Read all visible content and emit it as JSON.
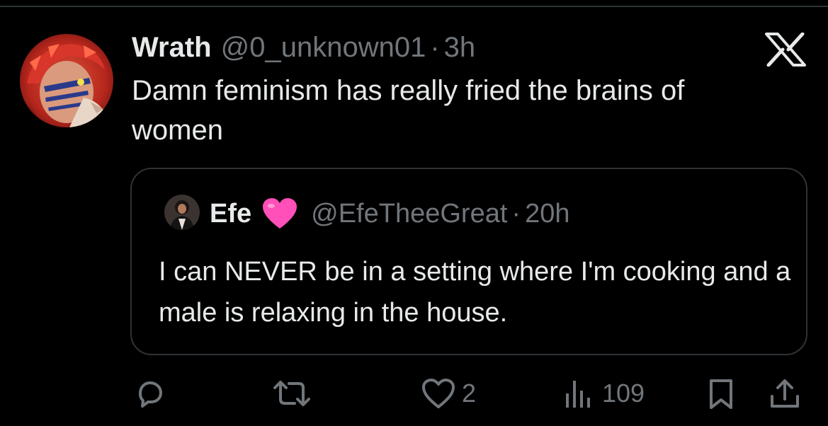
{
  "post": {
    "author_name": "Wrath",
    "author_handle": "@0_unknown01",
    "separator": "·",
    "time": "3h",
    "text": "Damn feminism has really fried the brains of women",
    "avatar_icon": "anime-character-avatar",
    "platform_icon": "x-logo-icon"
  },
  "quote": {
    "author_name": "Efe",
    "emoji": "pink-heart-emoji",
    "author_handle": "@EfeTheeGreat",
    "separator": "·",
    "time": "20h",
    "text": "I can NEVER be in a setting where I'm cooking and a male is relaxing in the house."
  },
  "actions": {
    "reply_icon": "reply-icon",
    "repost_icon": "repost-icon",
    "like_icon": "heart-icon",
    "like_count": "2",
    "views_icon": "views-icon",
    "views_count": "109",
    "bookmark_icon": "bookmark-icon",
    "share_icon": "share-icon"
  },
  "colors": {
    "background": "#000000",
    "text_primary": "#e7e9ea",
    "text_secondary": "#71767b",
    "border": "#2f3336",
    "heart_emoji": "#ff4fb8"
  }
}
